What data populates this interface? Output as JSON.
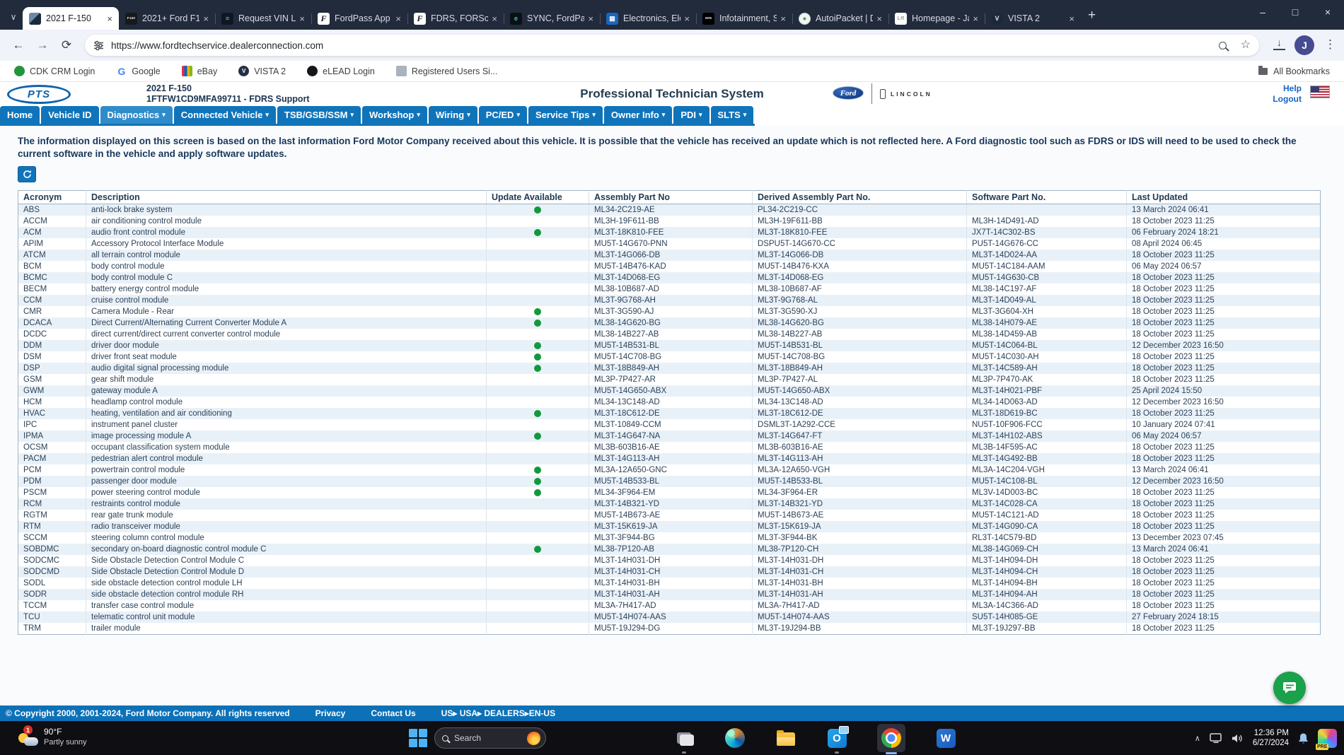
{
  "colors": {
    "nav_blue": "#1074ba",
    "nav_active_blue": "#2f8cca",
    "footer_blue": "#0d71b8",
    "update_dot_green": "#12993c",
    "link_blue": "#1565c0",
    "row_alt_blue": "#e9f1f8",
    "chat_green": "#1ba04b"
  },
  "browser": {
    "url": "https://www.fordtechservice.dealerconnection.com",
    "profile_initial": "J",
    "all_bookmarks": "All Bookmarks",
    "tabs": [
      {
        "label": "2021 F-150",
        "icon": "pts",
        "glyph": "",
        "active": true
      },
      {
        "label": "2021+ Ford F1",
        "icon": "forum",
        "glyph": "F150",
        "active": false
      },
      {
        "label": "Request VIN Lo",
        "icon": "vin",
        "glyph": "≡",
        "active": false
      },
      {
        "label": "FordPass App",
        "icon": "fordpass",
        "glyph": "F",
        "active": false
      },
      {
        "label": "FDRS, FORScan",
        "icon": "fordpass",
        "glyph": "F",
        "active": false
      },
      {
        "label": "SYNC, FordPas",
        "icon": "sync",
        "glyph": "e",
        "active": false
      },
      {
        "label": "Electronics, Ele",
        "icon": "electronics",
        "glyph": "▦",
        "active": false
      },
      {
        "label": "Infotainment, S",
        "icon": "m76",
        "glyph": "M76",
        "active": false
      },
      {
        "label": "AutoiPacket | D",
        "icon": "autopacket",
        "glyph": "●",
        "active": false
      },
      {
        "label": "Homepage - Ja",
        "icon": "jlr",
        "glyph": "LR",
        "active": false
      },
      {
        "label": "VISTA 2",
        "icon": "vista",
        "glyph": "V",
        "active": false
      }
    ],
    "bookmarks": [
      {
        "label": "CDK CRM Login",
        "icon": "cdk",
        "glyph": ""
      },
      {
        "label": "Google",
        "icon": "google",
        "glyph": "G"
      },
      {
        "label": "eBay",
        "icon": "ebay",
        "glyph": ""
      },
      {
        "label": "VISTA 2",
        "icon": "vista",
        "glyph": "V"
      },
      {
        "label": "eLEAD Login",
        "icon": "elead",
        "glyph": ""
      },
      {
        "label": "Registered Users Si...",
        "icon": "regusers",
        "glyph": ""
      }
    ]
  },
  "header": {
    "logo": "PTS",
    "vehicle": "2021 F-150",
    "vin_line": "1FTFW1CD9MFA99711 - FDRS Support",
    "title": "Professional Technician System",
    "ford": "Ford",
    "lincoln": "LINCOLN",
    "help": "Help",
    "logout": "Logout"
  },
  "nav": {
    "items": [
      {
        "label": "Home",
        "dropdown": false,
        "active": false
      },
      {
        "label": "Vehicle ID",
        "dropdown": false,
        "active": false
      },
      {
        "label": "Diagnostics",
        "dropdown": true,
        "active": true
      },
      {
        "label": "Connected Vehicle",
        "dropdown": true,
        "active": false
      },
      {
        "label": "TSB/GSB/SSM",
        "dropdown": true,
        "active": false
      },
      {
        "label": "Workshop",
        "dropdown": true,
        "active": false
      },
      {
        "label": "Wiring",
        "dropdown": true,
        "active": false
      },
      {
        "label": "PC/ED",
        "dropdown": true,
        "active": false
      },
      {
        "label": "Service Tips",
        "dropdown": true,
        "active": false
      },
      {
        "label": "Owner Info",
        "dropdown": true,
        "active": false
      },
      {
        "label": "PDI",
        "dropdown": true,
        "active": false
      },
      {
        "label": "SLTS",
        "dropdown": true,
        "active": false
      }
    ]
  },
  "notice": "The information displayed on this screen is based on the last information Ford Motor Company received about this vehicle. It is possible that the vehicle has received an update which is not reflected here. A Ford diagnostic tool such as FDRS or IDS will need to be used to check the current software in the vehicle and apply software updates.",
  "table": {
    "columns": [
      "Acronym",
      "Description",
      "Update Available",
      "Assembly Part No",
      "Derived Assembly Part No.",
      "Software Part No.",
      "Last Updated"
    ],
    "rows": [
      [
        "ABS",
        "anti-lock brake system",
        true,
        "ML34-2C219-AE",
        "PL34-2C219-CC",
        "",
        "13 March 2024 06:41"
      ],
      [
        "ACCM",
        "air conditioning control module",
        false,
        "ML3H-19F611-BB",
        "ML3H-19F611-BB",
        "ML3H-14D491-AD",
        "18 October 2023 11:25"
      ],
      [
        "ACM",
        "audio front control module",
        true,
        "ML3T-18K810-FEE",
        "ML3T-18K810-FEE",
        "JX7T-14C302-BS",
        "06 February 2024 18:21"
      ],
      [
        "APIM",
        "Accessory Protocol Interface Module",
        false,
        "MU5T-14G670-PNN",
        "DSPU5T-14G670-CC",
        "PU5T-14G676-CC",
        "08 April 2024 06:45"
      ],
      [
        "ATCM",
        "all terrain control module",
        false,
        "ML3T-14G066-DB",
        "ML3T-14G066-DB",
        "ML3T-14D024-AA",
        "18 October 2023 11:25"
      ],
      [
        "BCM",
        "body control module",
        false,
        "MU5T-14B476-KAD",
        "MU5T-14B476-KXA",
        "MU5T-14C184-AAM",
        "06 May 2024 06:57"
      ],
      [
        "BCMC",
        "body control module C",
        false,
        "ML3T-14D068-EG",
        "ML3T-14D068-EG",
        "MU5T-14G630-CB",
        "18 October 2023 11:25"
      ],
      [
        "BECM",
        "battery energy control module",
        false,
        "ML38-10B687-AD",
        "ML38-10B687-AF",
        "ML38-14C197-AF",
        "18 October 2023 11:25"
      ],
      [
        "CCM",
        "cruise control module",
        false,
        "ML3T-9G768-AH",
        "ML3T-9G768-AL",
        "ML3T-14D049-AL",
        "18 October 2023 11:25"
      ],
      [
        "CMR",
        "Camera Module - Rear",
        true,
        "ML3T-3G590-AJ",
        "ML3T-3G590-XJ",
        "ML3T-3G604-XH",
        "18 October 2023 11:25"
      ],
      [
        "DCACA",
        "Direct Current/Alternating Current Converter Module A",
        true,
        "ML38-14G620-BG",
        "ML38-14G620-BG",
        "ML38-14H079-AE",
        "18 October 2023 11:25"
      ],
      [
        "DCDC",
        "direct current/direct current converter control module",
        false,
        "ML38-14B227-AB",
        "ML38-14B227-AB",
        "ML38-14D459-AB",
        "18 October 2023 11:25"
      ],
      [
        "DDM",
        "driver door module",
        true,
        "MU5T-14B531-BL",
        "MU5T-14B531-BL",
        "MU5T-14C064-BL",
        "12 December 2023 16:50"
      ],
      [
        "DSM",
        "driver front seat module",
        true,
        "MU5T-14C708-BG",
        "MU5T-14C708-BG",
        "MU5T-14C030-AH",
        "18 October 2023 11:25"
      ],
      [
        "DSP",
        "audio digital signal processing module",
        true,
        "ML3T-18B849-AH",
        "ML3T-18B849-AH",
        "ML3T-14C589-AH",
        "18 October 2023 11:25"
      ],
      [
        "GSM",
        "gear shift module",
        false,
        "ML3P-7P427-AR",
        "ML3P-7P427-AL",
        "ML3P-7P470-AK",
        "18 October 2023 11:25"
      ],
      [
        "GWM",
        "gateway module A",
        false,
        "MU5T-14G650-ABX",
        "MU5T-14G650-ABX",
        "ML3T-14H021-PBF",
        "25 April 2024 15:50"
      ],
      [
        "HCM",
        "headlamp control module",
        false,
        "ML34-13C148-AD",
        "ML34-13C148-AD",
        "ML34-14D063-AD",
        "12 December 2023 16:50"
      ],
      [
        "HVAC",
        "heating, ventilation and air conditioning",
        true,
        "ML3T-18C612-DE",
        "ML3T-18C612-DE",
        "ML3T-18D619-BC",
        "18 October 2023 11:25"
      ],
      [
        "IPC",
        "instrument panel cluster",
        false,
        "ML3T-10849-CCM",
        "DSML3T-1A292-CCE",
        "NU5T-10F906-FCC",
        "10 January 2024 07:41"
      ],
      [
        "IPMA",
        "image processing module A",
        true,
        "ML3T-14G647-NA",
        "ML3T-14G647-FT",
        "ML3T-14H102-ABS",
        "06 May 2024 06:57"
      ],
      [
        "OCSM",
        "occupant classification system module",
        false,
        "ML3B-603B16-AE",
        "ML3B-603B16-AE",
        "ML3B-14F595-AC",
        "18 October 2023 11:25"
      ],
      [
        "PACM",
        "pedestrian alert control module",
        false,
        "ML3T-14G113-AH",
        "ML3T-14G113-AH",
        "ML3T-14G492-BB",
        "18 October 2023 11:25"
      ],
      [
        "PCM",
        "powertrain control module",
        true,
        "ML3A-12A650-GNC",
        "ML3A-12A650-VGH",
        "ML3A-14C204-VGH",
        "13 March 2024 06:41"
      ],
      [
        "PDM",
        "passenger door module",
        true,
        "MU5T-14B533-BL",
        "MU5T-14B533-BL",
        "MU5T-14C108-BL",
        "12 December 2023 16:50"
      ],
      [
        "PSCM",
        "power steering control module",
        true,
        "ML34-3F964-EM",
        "ML34-3F964-ER",
        "ML3V-14D003-BC",
        "18 October 2023 11:25"
      ],
      [
        "RCM",
        "restraints control module",
        false,
        "ML3T-14B321-YD",
        "ML3T-14B321-YD",
        "ML3T-14C028-CA",
        "18 October 2023 11:25"
      ],
      [
        "RGTM",
        "rear gate trunk module",
        false,
        "MU5T-14B673-AE",
        "MU5T-14B673-AE",
        "MU5T-14C121-AD",
        "18 October 2023 11:25"
      ],
      [
        "RTM",
        "radio transceiver module",
        false,
        "ML3T-15K619-JA",
        "ML3T-15K619-JA",
        "ML3T-14G090-CA",
        "18 October 2023 11:25"
      ],
      [
        "SCCM",
        "steering column control module",
        false,
        "ML3T-3F944-BG",
        "ML3T-3F944-BK",
        "RL3T-14C579-BD",
        "13 December 2023 07:45"
      ],
      [
        "SOBDMC",
        "secondary on-board diagnostic control module C",
        true,
        "ML38-7P120-AB",
        "ML38-7P120-CH",
        "ML38-14G069-CH",
        "13 March 2024 06:41"
      ],
      [
        "SODCMC",
        "Side Obstacle Detection Control Module C",
        false,
        "ML3T-14H031-DH",
        "ML3T-14H031-DH",
        "ML3T-14H094-DH",
        "18 October 2023 11:25"
      ],
      [
        "SODCMD",
        "Side Obstacle Detection Control Module D",
        false,
        "ML3T-14H031-CH",
        "ML3T-14H031-CH",
        "ML3T-14H094-CH",
        "18 October 2023 11:25"
      ],
      [
        "SODL",
        "side obstacle detection control module LH",
        false,
        "ML3T-14H031-BH",
        "ML3T-14H031-BH",
        "ML3T-14H094-BH",
        "18 October 2023 11:25"
      ],
      [
        "SODR",
        "side obstacle detection control module RH",
        false,
        "ML3T-14H031-AH",
        "ML3T-14H031-AH",
        "ML3T-14H094-AH",
        "18 October 2023 11:25"
      ],
      [
        "TCCM",
        "transfer case control module",
        false,
        "ML3A-7H417-AD",
        "ML3A-7H417-AD",
        "ML3A-14C366-AD",
        "18 October 2023 11:25"
      ],
      [
        "TCU",
        "telematic control unit module",
        false,
        "MU5T-14H074-AAS",
        "MU5T-14H074-AAS",
        "SU5T-14H085-GE",
        "27 February 2024 18:15"
      ],
      [
        "TRM",
        "trailer module",
        false,
        "MU5T-19J294-DG",
        "ML3T-19J294-BB",
        "ML3T-19J297-BB",
        "18 October 2023 11:25"
      ]
    ]
  },
  "footer": {
    "copyright": "© Copyright 2000, 2001-2024, Ford Motor Company. All rights reserved",
    "links": [
      "Privacy",
      "Contact Us"
    ],
    "locale": "US▸ USA▸ DEALERS▸EN-US"
  },
  "taskbar": {
    "weather_temp": "90°F",
    "weather_condition": "Partly sunny",
    "weather_badge": "1",
    "search_placeholder": "Search",
    "time": "12:36 PM",
    "date": "6/27/2024",
    "tray_badge": "PRE"
  }
}
